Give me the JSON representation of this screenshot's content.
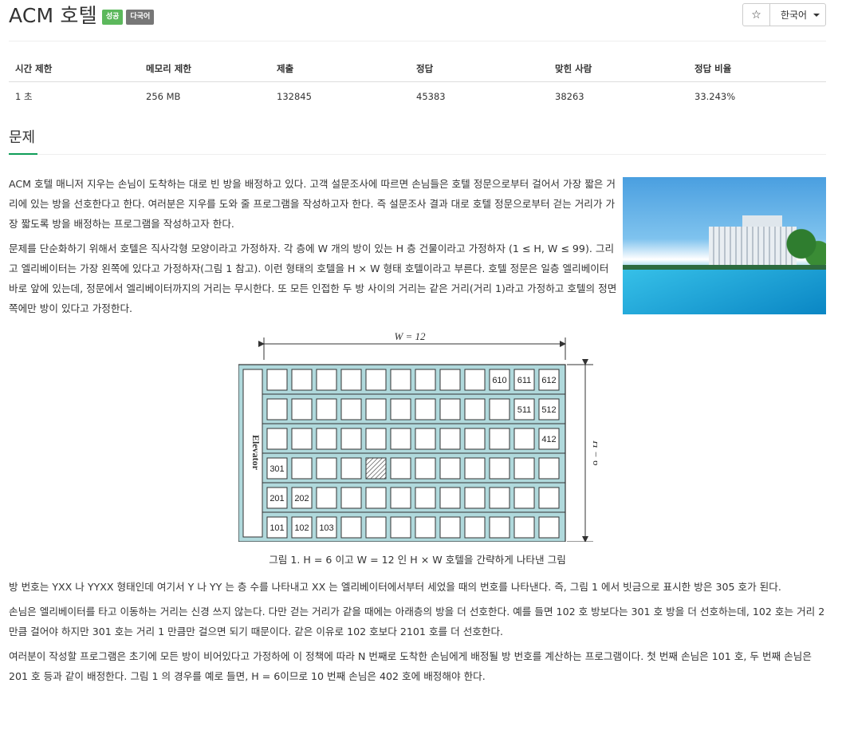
{
  "header": {
    "title": "ACM 호텔",
    "badge_success": "성공",
    "badge_lang": "다국어",
    "star": "☆",
    "language": "한국어"
  },
  "info": {
    "columns": [
      "시간 제한",
      "메모리 제한",
      "제출",
      "정답",
      "맞힌 사람",
      "정답 비율"
    ],
    "values": [
      "1 초",
      "256 MB",
      "132845",
      "45383",
      "38263",
      "33.243%"
    ]
  },
  "section": {
    "title": "문제"
  },
  "problem": {
    "p1": "ACM 호텔 매니저 지우는 손님이 도착하는 대로 빈 방을 배정하고 있다. 고객 설문조사에 따르면 손님들은 호텔 정문으로부터 걸어서 가장 짧은 거리에 있는 방을 선호한다고 한다. 여러분은 지우를 도와 줄 프로그램을 작성하고자 한다. 즉 설문조사 결과 대로 호텔 정문으로부터 걷는 거리가 가장 짧도록 방을 배정하는 프로그램을 작성하고자 한다.",
    "p2": "문제를 단순화하기 위해서 호텔은 직사각형 모양이라고 가정하자. 각 층에 W 개의 방이 있는 H 층 건물이라고 가정하자 (1 ≤ H, W ≤ 99). 그리고 엘리베이터는 가장 왼쪽에 있다고 가정하자(그림 1 참고). 이런 형태의 호텔을 H × W 형태 호텔이라고 부른다. 호텔 정문은 일층 엘리베이터 바로 앞에 있는데, 정문에서 엘리베이터까지의 거리는 무시한다. 또 모든 인접한 두 방 사이의 거리는 같은 거리(거리 1)라고 가정하고 호텔의 정면 쪽에만 방이 있다고 가정한다.",
    "p3": "방 번호는 YXX 나 YYXX 형태인데 여기서 Y 나 YY 는 층 수를 나타내고 XX 는 엘리베이터에서부터 세었을 때의 번호를 나타낸다. 즉, 그림 1 에서 빗금으로 표시한 방은 305 호가 된다.",
    "p4": "손님은 엘리베이터를 타고 이동하는 거리는 신경 쓰지 않는다. 다만 걷는 거리가 같을 때에는 아래층의 방을 더 선호한다. 예를 들면 102 호 방보다는 301 호 방을 더 선호하는데, 102 호는 거리 2 만큼 걸어야 하지만 301 호는 거리 1 만큼만 걸으면 되기 때문이다. 같은 이유로 102 호보다 2101 호를 더 선호한다.",
    "p5": "여러분이 작성할 프로그램은 초기에 모든 방이 비어있다고 가정하에 이 정책에 따라 N 번째로 도착한 손님에게 배정될 방 번호를 계산하는 프로그램이다. 첫 번째 손님은 101 호, 두 번째 손님은 201 호 등과 같이 배정한다. 그림 1 의 경우를 예로 들면, H = 6이므로 10 번째 손님은 402 호에 배정해야 한다."
  },
  "figure": {
    "w_label": "W = 12",
    "h_label": "H = 6",
    "elevator": "Elevator",
    "caption": "그림 1. H = 6 이고 W = 12 인 H × W 호텔을 간략하게 나타낸 그림",
    "rows": [
      [
        "",
        "",
        "",
        "",
        "",
        "",
        "",
        "",
        "",
        "610",
        "611",
        "612"
      ],
      [
        "",
        "",
        "",
        "",
        "",
        "",
        "",
        "",
        "",
        "",
        "511",
        "512"
      ],
      [
        "",
        "",
        "",
        "",
        "",
        "",
        "",
        "",
        "",
        "",
        "",
        "412"
      ],
      [
        "301",
        "",
        "",
        "",
        "",
        "",
        "",
        "",
        "",
        "",
        "",
        ""
      ],
      [
        "201",
        "202",
        "",
        "",
        "",
        "",
        "",
        "",
        "",
        "",
        "",
        ""
      ],
      [
        "101",
        "102",
        "103",
        "",
        "",
        "",
        "",
        "",
        "",
        "",
        "",
        ""
      ]
    ],
    "hatched_room": {
      "floor_index": 3,
      "col": 4
    },
    "colors": {
      "building": "#b0d9dc",
      "outline": "#333333",
      "room": "#ffffff"
    }
  }
}
